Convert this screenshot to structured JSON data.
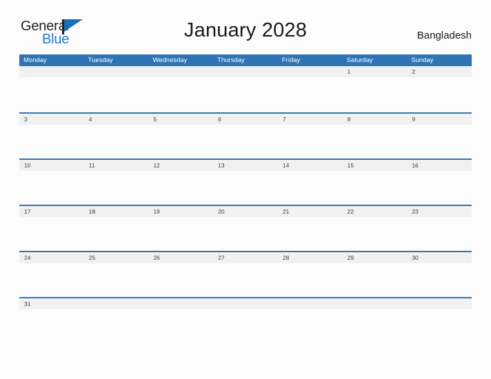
{
  "logo": {
    "word_top": "General",
    "word_bottom": "Blue",
    "mark": "flag-triangle"
  },
  "header": {
    "title": "January 2028",
    "country": "Bangladesh"
  },
  "colors": {
    "header_blue": "#2e74b5",
    "rule_blue": "#2e74b5",
    "strip_gray": "#f1f1f1",
    "logo_blue": "#1f7bc8",
    "text_dark": "#1a1a1a",
    "date_text": "#3d3d3d"
  },
  "calendar": {
    "weekdays": [
      "Monday",
      "Tuesday",
      "Wednesday",
      "Thursday",
      "Friday",
      "Saturday",
      "Sunday"
    ],
    "weeks": [
      [
        "",
        "",
        "",
        "",
        "",
        "1",
        "2"
      ],
      [
        "3",
        "4",
        "5",
        "6",
        "7",
        "8",
        "9"
      ],
      [
        "10",
        "11",
        "12",
        "13",
        "14",
        "15",
        "16"
      ],
      [
        "17",
        "18",
        "19",
        "20",
        "21",
        "22",
        "23"
      ],
      [
        "24",
        "25",
        "26",
        "27",
        "28",
        "29",
        "30"
      ],
      [
        "31",
        "",
        "",
        "",
        "",
        "",
        ""
      ]
    ]
  }
}
